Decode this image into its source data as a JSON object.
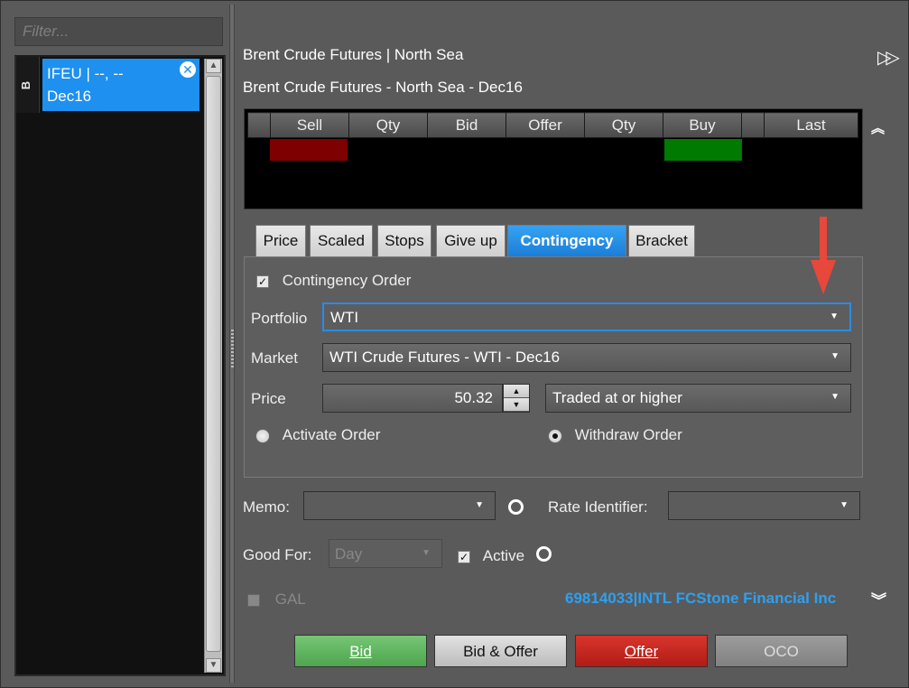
{
  "left": {
    "filter_placeholder": "Filter...",
    "side_tab": "B",
    "selected_item": {
      "line1": "IFEU | --, --",
      "line2": "Dec16"
    }
  },
  "header": {
    "title": "Brent Crude Futures | North Sea",
    "subtitle": "Brent Crude Futures - North Sea - Dec16"
  },
  "ladder": {
    "columns": [
      "",
      "Sell",
      "Qty",
      "Bid",
      "Offer",
      "Qty",
      "Buy",
      "",
      "Last"
    ]
  },
  "tabs": [
    {
      "label": "Price",
      "active": false
    },
    {
      "label": "Scaled",
      "active": false
    },
    {
      "label": "Stops",
      "active": false
    },
    {
      "label": "Give up",
      "active": false
    },
    {
      "label": "Contingency",
      "active": true
    },
    {
      "label": "Bracket",
      "active": false
    }
  ],
  "contingency": {
    "checkbox_label": "Contingency Order",
    "checked": true,
    "portfolio_label": "Portfolio",
    "portfolio_value": "WTI",
    "market_label": "Market",
    "market_value": "WTI Crude Futures - WTI - Dec16",
    "price_label": "Price",
    "price_value": "50.32",
    "condition_value": "Traded at or higher",
    "radio_activate": "Activate Order",
    "radio_withdraw": "Withdraw Order",
    "selected_radio": "Withdraw Order"
  },
  "order": {
    "memo_label": "Memo:",
    "rate_identifier_label": "Rate Identifier:",
    "good_for_label": "Good For:",
    "good_for_value": "Day",
    "active_label": "Active",
    "active_checked": true,
    "gal_label": "GAL",
    "account": "69814033|INTL FCStone Financial Inc"
  },
  "buttons": {
    "bid": "Bid",
    "bid_offer": "Bid & Offer",
    "offer": "Offer",
    "oco": "OCO"
  },
  "colors": {
    "accent_blue": "#1e90ef",
    "bid_green": "#5cb85c",
    "offer_red": "#c9241c",
    "annotation_arrow": "#e8473c"
  }
}
